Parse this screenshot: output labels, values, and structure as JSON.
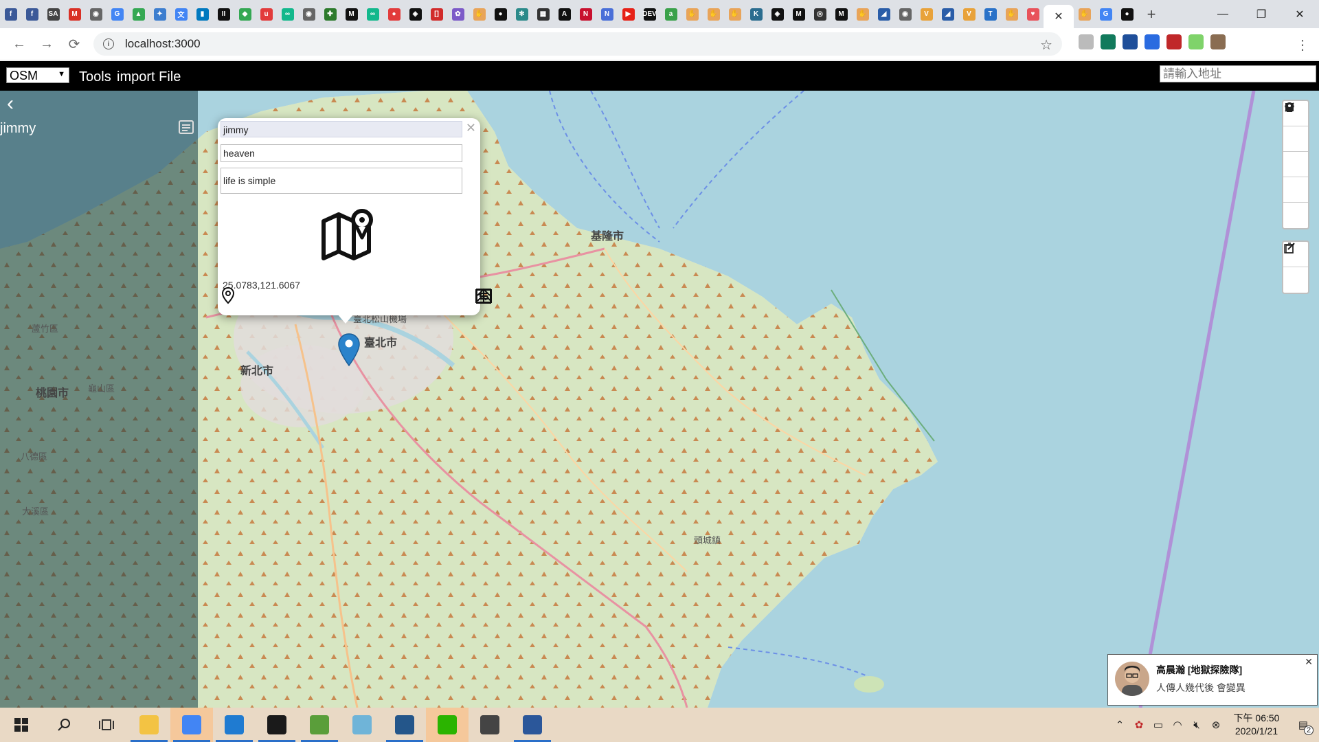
{
  "browser": {
    "url": "localhost:3000",
    "tab_favicons": [
      {
        "name": "facebook-favicon",
        "color": "#3b5998",
        "glyph": "f"
      },
      {
        "name": "facebook-favicon",
        "color": "#3b5998",
        "glyph": "f"
      },
      {
        "name": "sa-favicon",
        "color": "#444444",
        "glyph": "SA"
      },
      {
        "name": "gmail-favicon",
        "color": "#d93025",
        "glyph": "M"
      },
      {
        "name": "globe-favicon",
        "color": "#666666",
        "glyph": "◉"
      },
      {
        "name": "google-favicon",
        "color": "#4285f4",
        "glyph": "G"
      },
      {
        "name": "drive-favicon",
        "color": "#34a853",
        "glyph": "▲"
      },
      {
        "name": "app-favicon",
        "color": "#3d7ecf",
        "glyph": "✦"
      },
      {
        "name": "translate-favicon",
        "color": "#4285f4",
        "glyph": "文"
      },
      {
        "name": "trello-favicon",
        "color": "#0079bf",
        "glyph": "▮"
      },
      {
        "name": "ii-favicon",
        "color": "#111111",
        "glyph": "II"
      },
      {
        "name": "maps-favicon",
        "color": "#34a853",
        "glyph": "◆"
      },
      {
        "name": "u-favicon",
        "color": "#e23b3b",
        "glyph": "u"
      },
      {
        "name": "loop-favicon",
        "color": "#13b88c",
        "glyph": "∞"
      },
      {
        "name": "globe-favicon",
        "color": "#666666",
        "glyph": "◉"
      },
      {
        "name": "leaf-favicon",
        "color": "#2c7a2c",
        "glyph": "✚"
      },
      {
        "name": "medium-favicon",
        "color": "#111111",
        "glyph": "M"
      },
      {
        "name": "loop-favicon",
        "color": "#13b88c",
        "glyph": "∞"
      },
      {
        "name": "pin-favicon",
        "color": "#e23b3b",
        "glyph": "●"
      },
      {
        "name": "codepen-favicon",
        "color": "#111111",
        "glyph": "◈"
      },
      {
        "name": "bracket-favicon",
        "color": "#d12b2b",
        "glyph": "[]"
      },
      {
        "name": "knot-favicon",
        "color": "#7c5ac8",
        "glyph": "✿"
      },
      {
        "name": "hand-favicon",
        "color": "#e8a45a",
        "glyph": "✋"
      },
      {
        "name": "github-favicon",
        "color": "#111111",
        "glyph": "●"
      },
      {
        "name": "react-favicon",
        "color": "#2b8a8a",
        "glyph": "✻"
      },
      {
        "name": "film-favicon",
        "color": "#333333",
        "glyph": "▦"
      },
      {
        "name": "code-favicon",
        "color": "#111111",
        "glyph": "A"
      },
      {
        "name": "notion-favicon",
        "color": "#c8102e",
        "glyph": "N"
      },
      {
        "name": "n-favicon",
        "color": "#4a6fd8",
        "glyph": "N"
      },
      {
        "name": "youtube-favicon",
        "color": "#e62117",
        "glyph": "▶"
      },
      {
        "name": "dev-favicon",
        "color": "#111111",
        "glyph": "DEV"
      },
      {
        "name": "a-favicon",
        "color": "#3aa14a",
        "glyph": "a"
      },
      {
        "name": "hand-favicon",
        "color": "#e8a45a",
        "glyph": "✋"
      },
      {
        "name": "hand-favicon",
        "color": "#e8a45a",
        "glyph": "✋"
      },
      {
        "name": "hand-favicon",
        "color": "#e8a45a",
        "glyph": "✋"
      },
      {
        "name": "k-favicon",
        "color": "#2b6d8f",
        "glyph": "K"
      },
      {
        "name": "codepen-favicon",
        "color": "#111111",
        "glyph": "◈"
      },
      {
        "name": "medium-favicon",
        "color": "#111111",
        "glyph": "M"
      },
      {
        "name": "eye-favicon",
        "color": "#333333",
        "glyph": "◎"
      },
      {
        "name": "medium-favicon",
        "color": "#111111",
        "glyph": "M"
      },
      {
        "name": "hand-favicon",
        "color": "#e8a45a",
        "glyph": "✋"
      },
      {
        "name": "wing-favicon",
        "color": "#2a5da8",
        "glyph": "◢"
      },
      {
        "name": "globe-favicon",
        "color": "#666666",
        "glyph": "◉"
      },
      {
        "name": "v-favicon",
        "color": "#e8a23a",
        "glyph": "V"
      },
      {
        "name": "wing-favicon",
        "color": "#2a5da8",
        "glyph": "◢"
      },
      {
        "name": "v-favicon",
        "color": "#e8a23a",
        "glyph": "V"
      },
      {
        "name": "t-favicon",
        "color": "#2a72c8",
        "glyph": "T"
      },
      {
        "name": "hand-favicon",
        "color": "#e8a45a",
        "glyph": "✋"
      },
      {
        "name": "heart-favicon",
        "color": "#e8525a",
        "glyph": "♥"
      }
    ],
    "after_favicons": [
      {
        "name": "hand-favicon",
        "color": "#e8a45a",
        "glyph": "✋"
      },
      {
        "name": "google-favicon",
        "color": "#4285f4",
        "glyph": "G"
      },
      {
        "name": "github-favicon",
        "color": "#111111",
        "glyph": "●"
      }
    ],
    "extensions": [
      {
        "name": "ext-icon",
        "color": "#bbbbbb"
      },
      {
        "name": "ext-icon",
        "color": "#127a5c"
      },
      {
        "name": "ext-icon",
        "color": "#1f4f9a"
      },
      {
        "name": "ext-icon",
        "color": "#2a6be0"
      },
      {
        "name": "ext-icon",
        "color": "#c0282a"
      },
      {
        "name": "ext-icon",
        "color": "#7fd36a"
      },
      {
        "name": "ext-icon",
        "color": "#8a6d52"
      }
    ]
  },
  "app": {
    "basemap": "OSM",
    "menu": {
      "tools": "Tools",
      "import": "import File"
    },
    "address_placeholder": "請輸入地址"
  },
  "sidebar": {
    "user": "jimmy"
  },
  "map": {
    "labels": [
      {
        "text": "基隆市",
        "cls": ""
      },
      {
        "text": "臺北市",
        "cls": ""
      },
      {
        "text": "新北市",
        "cls": ""
      },
      {
        "text": "桃園市",
        "cls": ""
      },
      {
        "text": "蘆竹區",
        "cls": "sm"
      },
      {
        "text": "龜山區",
        "cls": "sm"
      },
      {
        "text": "八德區",
        "cls": "sm"
      },
      {
        "text": "大溪區",
        "cls": "sm"
      },
      {
        "text": "頭城鎮",
        "cls": "sm"
      },
      {
        "text": "臺北松山機場",
        "cls": "sm"
      }
    ]
  },
  "popup": {
    "title": "jimmy",
    "subtitle": "heaven",
    "description": "life is simple",
    "coords": "25.0783,121.6067"
  },
  "notification": {
    "title": "高晨瀚 [地獄探險隊]",
    "message": "人傳人幾代後 會變異"
  },
  "taskbar": {
    "apps": [
      {
        "name": "file-explorer-icon",
        "color": "#f3c343",
        "running": true,
        "active": false
      },
      {
        "name": "chrome-icon",
        "color": "#4285f4",
        "running": true,
        "active": true
      },
      {
        "name": "vscode-icon",
        "color": "#1f7bd1",
        "running": true,
        "active": false
      },
      {
        "name": "terminal-icon",
        "color": "#1a1a1a",
        "running": true,
        "active": false
      },
      {
        "name": "image-editor-icon",
        "color": "#5a9e3a",
        "running": true,
        "active": false
      },
      {
        "name": "mail-icon",
        "color": "#6fb4d8",
        "running": false,
        "active": false
      },
      {
        "name": "mysql-icon",
        "color": "#24568a",
        "running": true,
        "active": false
      },
      {
        "name": "line-icon",
        "color": "#2bb400",
        "running": false,
        "active": true
      },
      {
        "name": "photos-icon",
        "color": "#444444",
        "running": false,
        "active": false
      },
      {
        "name": "word-icon",
        "color": "#2b579a",
        "running": true,
        "active": false
      }
    ],
    "clock_time": "下午 06:50",
    "clock_date": "2020/1/21",
    "notification_count": "2"
  }
}
